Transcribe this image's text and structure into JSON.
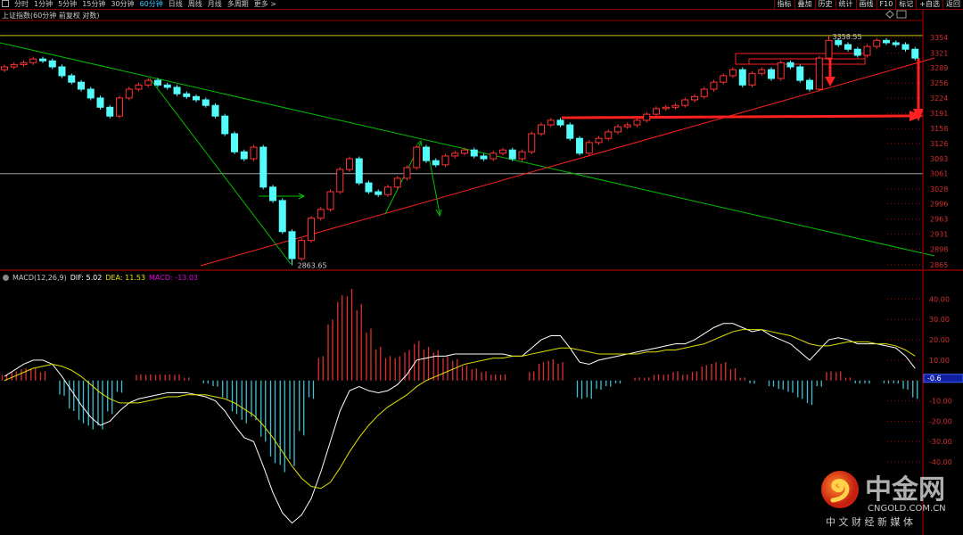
{
  "toolbar": {
    "periods": [
      "分时",
      "1分钟",
      "5分钟",
      "15分钟",
      "30分钟",
      "60分钟",
      "日线",
      "周线",
      "月线",
      "多周期",
      "更多 >"
    ],
    "active_period": "60分钟",
    "right_tools": [
      "指标",
      "叠加",
      "历史",
      "统计",
      "画线",
      "F10",
      "标记",
      "+自选",
      "返回"
    ]
  },
  "title": "上证指数(60分钟 前复权 对数)",
  "macd_label": {
    "name": "MACD(12,26,9)",
    "dif": "DIF: 5.02",
    "dea": "DEA: 11.53",
    "macd": "MACD: -13.03"
  },
  "colors": {
    "up": "#ff3232",
    "down": "#54fcfc",
    "dif": "#ffffff",
    "dea": "#e0e000",
    "macd": "#ff00ff",
    "axis": "#c00000",
    "trend_green": "#00c000",
    "trend_red": "#ff2020"
  },
  "logo": {
    "name": "中金网",
    "domain": "CNGOLD.COM.CN",
    "slogan": "中 文 财 经 新 媒 体"
  },
  "chart_data": [
    {
      "type": "candlestick",
      "title": "上证指数(60分钟 前复权 对数)",
      "ylim": [
        2853,
        3389
      ],
      "yticks": [
        3354,
        3321,
        3289,
        3256,
        3224,
        3191,
        3158,
        3126,
        3093,
        3061,
        3028,
        2996,
        2963,
        2931,
        2898,
        2865
      ],
      "high_label": "3358.55",
      "low_label": "2863.65",
      "horizontal_line": 3061,
      "candles": [
        [
          3285,
          3296,
          3280,
          3291
        ],
        [
          3291,
          3301,
          3286,
          3296
        ],
        [
          3296,
          3305,
          3291,
          3300
        ],
        [
          3300,
          3313,
          3295,
          3308
        ],
        [
          3308,
          3313,
          3299,
          3304
        ],
        [
          3304,
          3309,
          3286,
          3291
        ],
        [
          3291,
          3296,
          3267,
          3272
        ],
        [
          3272,
          3277,
          3253,
          3258
        ],
        [
          3258,
          3263,
          3238,
          3243
        ],
        [
          3243,
          3248,
          3219,
          3224
        ],
        [
          3224,
          3229,
          3199,
          3204
        ],
        [
          3204,
          3209,
          3180,
          3185
        ],
        [
          3185,
          3229,
          3180,
          3224
        ],
        [
          3224,
          3248,
          3219,
          3243
        ],
        [
          3243,
          3257,
          3238,
          3252
        ],
        [
          3252,
          3267,
          3247,
          3262
        ],
        [
          3262,
          3267,
          3247,
          3252
        ],
        [
          3252,
          3257,
          3242,
          3247
        ],
        [
          3247,
          3252,
          3228,
          3233
        ],
        [
          3233,
          3238,
          3222,
          3227
        ],
        [
          3227,
          3232,
          3215,
          3220
        ],
        [
          3220,
          3225,
          3203,
          3208
        ],
        [
          3208,
          3213,
          3180,
          3185
        ],
        [
          3185,
          3190,
          3142,
          3147
        ],
        [
          3147,
          3152,
          3103,
          3108
        ],
        [
          3108,
          3113,
          3088,
          3093
        ],
        [
          3093,
          3123,
          3088,
          3118
        ],
        [
          3118,
          3123,
          3027,
          3032
        ],
        [
          3032,
          3037,
          2998,
          3003
        ],
        [
          3003,
          3008,
          2931,
          2936
        ],
        [
          2936,
          2941,
          2863.65,
          2878
        ],
        [
          2878,
          2922,
          2873,
          2917
        ],
        [
          2917,
          2970,
          2912,
          2965
        ],
        [
          2965,
          2989,
          2960,
          2984
        ],
        [
          2984,
          3027,
          2979,
          3022
        ],
        [
          3022,
          3075,
          3017,
          3070
        ],
        [
          3070,
          3098,
          3065,
          3093
        ],
        [
          3093,
          3098,
          3036,
          3041
        ],
        [
          3041,
          3046,
          3017,
          3022
        ],
        [
          3022,
          3027,
          3011,
          3016
        ],
        [
          3016,
          3037,
          3011,
          3032
        ],
        [
          3032,
          3056,
          3027,
          3051
        ],
        [
          3051,
          3079,
          3046,
          3074
        ],
        [
          3074,
          3123,
          3069,
          3118
        ],
        [
          3118,
          3123,
          3084,
          3089
        ],
        [
          3089,
          3094,
          3075,
          3080
        ],
        [
          3080,
          3104,
          3075,
          3099
        ],
        [
          3099,
          3110,
          3094,
          3105
        ],
        [
          3105,
          3117,
          3100,
          3112
        ],
        [
          3112,
          3117,
          3094,
          3099
        ],
        [
          3099,
          3104,
          3088,
          3093
        ],
        [
          3093,
          3110,
          3088,
          3105
        ],
        [
          3105,
          3117,
          3100,
          3112
        ],
        [
          3112,
          3117,
          3088,
          3093
        ],
        [
          3093,
          3113,
          3088,
          3108
        ],
        [
          3108,
          3152,
          3103,
          3147
        ],
        [
          3147,
          3171,
          3142,
          3166
        ],
        [
          3166,
          3181,
          3161,
          3176
        ],
        [
          3176,
          3181,
          3161,
          3166
        ],
        [
          3166,
          3171,
          3132,
          3137
        ],
        [
          3137,
          3142,
          3100,
          3105
        ],
        [
          3105,
          3133,
          3100,
          3128
        ],
        [
          3128,
          3142,
          3123,
          3137
        ],
        [
          3137,
          3156,
          3132,
          3151
        ],
        [
          3151,
          3167,
          3146,
          3162
        ],
        [
          3162,
          3171,
          3157,
          3166
        ],
        [
          3166,
          3181,
          3161,
          3176
        ],
        [
          3176,
          3194,
          3171,
          3189
        ],
        [
          3189,
          3206,
          3184,
          3201
        ],
        [
          3201,
          3209,
          3196,
          3204
        ],
        [
          3204,
          3213,
          3199,
          3208
        ],
        [
          3208,
          3225,
          3203,
          3220
        ],
        [
          3220,
          3232,
          3215,
          3227
        ],
        [
          3227,
          3248,
          3222,
          3243
        ],
        [
          3243,
          3263,
          3238,
          3258
        ],
        [
          3258,
          3277,
          3253,
          3272
        ],
        [
          3272,
          3290,
          3267,
          3285
        ],
        [
          3285,
          3290,
          3247,
          3252
        ],
        [
          3252,
          3282,
          3247,
          3277
        ],
        [
          3277,
          3290,
          3272,
          3285
        ],
        [
          3285,
          3290,
          3261,
          3266
        ],
        [
          3266,
          3305,
          3261,
          3300
        ],
        [
          3300,
          3305,
          3286,
          3291
        ],
        [
          3291,
          3296,
          3257,
          3262
        ],
        [
          3262,
          3267,
          3238,
          3243
        ],
        [
          3243,
          3315,
          3238,
          3310
        ],
        [
          3310,
          3358.55,
          3305,
          3348
        ],
        [
          3348,
          3353,
          3334,
          3339
        ],
        [
          3339,
          3344,
          3324,
          3329
        ],
        [
          3329,
          3334,
          3311,
          3316
        ],
        [
          3316,
          3340,
          3311,
          3335
        ],
        [
          3335,
          3353,
          3330,
          3348
        ],
        [
          3348,
          3353,
          3338,
          3343
        ],
        [
          3343,
          3348,
          3334,
          3339
        ],
        [
          3339,
          3344,
          3324,
          3329
        ],
        [
          3329,
          3334,
          3305,
          3310
        ]
      ]
    },
    {
      "type": "bar+line",
      "title": "MACD(12,26,9)",
      "ylim": [
        -75,
        52
      ],
      "yticks": [
        40,
        30,
        20,
        10,
        0,
        -10,
        -20,
        -30,
        -40
      ],
      "ytick_labels": [
        "40.00",
        "30.00",
        "20.00",
        "10.00",
        "0.00",
        "-10.00",
        "-20.00",
        "-30.00",
        "-40.00"
      ],
      "cursor_value": "-0.6",
      "series": [
        {
          "name": "DIF",
          "values": [
            2,
            5,
            8,
            10,
            10,
            8,
            2,
            -5,
            -12,
            -18,
            -22,
            -20,
            -15,
            -11,
            -9,
            -8,
            -7,
            -6,
            -6,
            -6,
            -7,
            -8,
            -10,
            -15,
            -22,
            -28,
            -30,
            -42,
            -55,
            -65,
            -70,
            -66,
            -58,
            -45,
            -30,
            -15,
            -5,
            -3,
            -5,
            -6,
            -5,
            -2,
            3,
            10,
            11,
            12,
            12,
            13,
            13,
            13,
            13,
            13,
            13,
            12,
            12,
            16,
            20,
            22,
            22,
            16,
            9,
            8,
            10,
            11,
            12,
            13,
            14,
            15,
            16,
            17,
            18,
            18,
            20,
            23,
            26,
            28,
            28,
            26,
            24,
            25,
            22,
            20,
            18,
            14,
            10,
            15,
            20,
            21,
            20,
            18,
            18,
            18,
            17,
            16,
            12,
            6
          ]
        },
        {
          "name": "DEA",
          "values": [
            0,
            2,
            4,
            6,
            7,
            8,
            7,
            5,
            2,
            -2,
            -6,
            -9,
            -11,
            -11,
            -11,
            -10,
            -9,
            -8,
            -8,
            -7,
            -7,
            -7,
            -8,
            -9,
            -11,
            -14,
            -17,
            -22,
            -28,
            -35,
            -42,
            -48,
            -52,
            -53,
            -50,
            -43,
            -35,
            -28,
            -22,
            -17,
            -13,
            -10,
            -7,
            -3,
            0,
            2,
            4,
            6,
            8,
            9,
            10,
            11,
            11,
            12,
            12,
            13,
            14,
            15,
            16,
            16,
            15,
            14,
            13,
            13,
            13,
            13,
            13,
            14,
            14,
            15,
            15,
            16,
            17,
            18,
            20,
            22,
            24,
            25,
            25,
            25,
            24,
            23,
            22,
            20,
            18,
            17,
            17,
            18,
            19,
            19,
            19,
            18,
            18,
            17,
            15,
            12
          ]
        },
        {
          "name": "MACD",
          "values": [
            3,
            4.5,
            6,
            6,
            4.5,
            0,
            -7.5,
            -15,
            -21,
            -24,
            -24,
            -16.5,
            -6,
            0,
            3,
            3,
            3,
            3,
            3,
            1.5,
            0,
            -1.5,
            -3,
            -9,
            -16.5,
            -21,
            -19.5,
            -30,
            -40.5,
            -45,
            -42,
            -27,
            -9,
            12,
            30,
            42,
            45,
            37.5,
            25.5,
            16.5,
            12,
            12,
            15,
            19.5,
            16.5,
            15,
            12,
            10.5,
            7.5,
            6,
            4.5,
            3,
            3,
            0,
            0,
            4.5,
            9,
            10.5,
            9,
            0,
            -9,
            -9,
            -4.5,
            -3,
            -1.5,
            0,
            1.5,
            1.5,
            3,
            3,
            4.5,
            3,
            4.5,
            7.5,
            9,
            9,
            6,
            1.5,
            -1.5,
            0,
            -3,
            -4.5,
            -6,
            -9,
            -12,
            -3,
            4.5,
            4.5,
            1.5,
            -1.5,
            -1.5,
            0,
            -1.5,
            -1.5,
            -4.5,
            -9
          ]
        }
      ]
    }
  ]
}
